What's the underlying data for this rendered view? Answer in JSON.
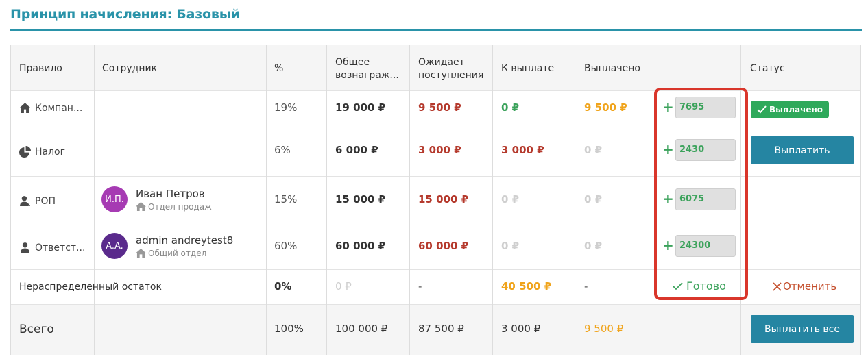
{
  "page": {
    "title": "Принцип начисления: Базовый"
  },
  "table": {
    "headers": {
      "rule": "Правило",
      "employee": "Сотрудник",
      "percent": "%",
      "total": "Общее вознаграж...",
      "expected": "Ожидает поступления",
      "to_pay": "К выплате",
      "paid": "Выплачено",
      "status": "Статус"
    },
    "rows": [
      {
        "rule": "Компан...",
        "rule_icon": "home-icon",
        "percent": "19%",
        "total": "19 000 ₽",
        "expected": "9 500 ₽",
        "to_pay": "0 ₽",
        "paid": "9 500 ₽",
        "input_value": "7695",
        "status_badge": "Выплачено"
      },
      {
        "rule": "Налог",
        "rule_icon": "pie-chart-icon",
        "percent": "6%",
        "total": "6 000 ₽",
        "expected": "3 000 ₽",
        "to_pay": "3 000 ₽",
        "paid": "0 ₽",
        "input_value": "2430",
        "status_button": "Выплатить"
      },
      {
        "rule": "РОП",
        "rule_icon": "user-tie-icon",
        "employee": {
          "name": "Иван Петров",
          "initials": "И.П.",
          "dept": "Отдел продаж",
          "avatar_color": "#a63bb3"
        },
        "percent": "15%",
        "total": "15 000 ₽",
        "expected": "15 000 ₽",
        "to_pay": "0 ₽",
        "paid": "0 ₽",
        "input_value": "6075"
      },
      {
        "rule": "Ответст...",
        "rule_icon": "user-icon",
        "employee": {
          "name": "admin andreytest8",
          "initials": "A.A.",
          "dept": "Общий отдел",
          "avatar_color": "#5a2a8c"
        },
        "percent": "60%",
        "total": "60 000 ₽",
        "expected": "60 000 ₽",
        "to_pay": "0 ₽",
        "paid": "0 ₽",
        "input_value": "24300"
      }
    ],
    "remainder": {
      "label": "Нераспределенный остаток",
      "percent": "0%",
      "total": "0 ₽",
      "expected": "-",
      "to_pay": "40 500 ₽",
      "paid": "-",
      "ready": "Готово",
      "cancel": "Отменить"
    },
    "totals": {
      "label": "Всего",
      "percent": "100%",
      "total": "100 000 ₽",
      "expected": "87 500 ₽",
      "to_pay": "3 000 ₽",
      "paid": "9 500 ₽",
      "button": "Выплатить все"
    }
  },
  "colors": {
    "accent": "#2a93a9",
    "button": "#2585a2",
    "success": "#2fa95b",
    "danger": "#b53a2d",
    "warning": "#f0a41c",
    "highlight": "#d9362b"
  }
}
